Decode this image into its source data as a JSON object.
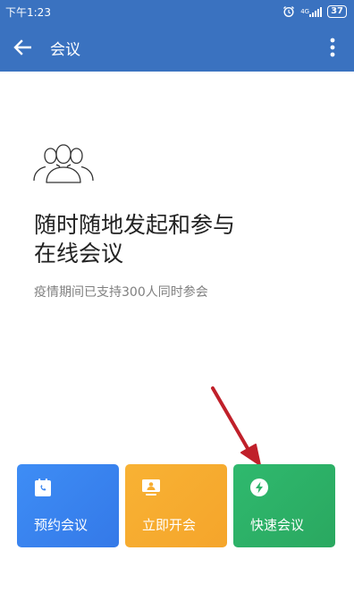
{
  "status_bar": {
    "time": "下午1:23",
    "network": "4G",
    "battery": "37"
  },
  "app_bar": {
    "title": "会议"
  },
  "hero": {
    "headline_line1": "随时随地发起和参与",
    "headline_line2": "在线会议",
    "subtitle": "疫情期间已支持300人同时参会"
  },
  "actions": [
    {
      "label": "预约会议",
      "icon": "calendar-phone-icon",
      "color": "#3a85f0"
    },
    {
      "label": "立即开会",
      "icon": "monitor-person-icon",
      "color": "#f7ad30"
    },
    {
      "label": "快速会议",
      "icon": "lightning-icon",
      "color": "#2db36a"
    }
  ],
  "colors": {
    "app_bar": "#3a72c0",
    "arrow": "#c0202a"
  }
}
